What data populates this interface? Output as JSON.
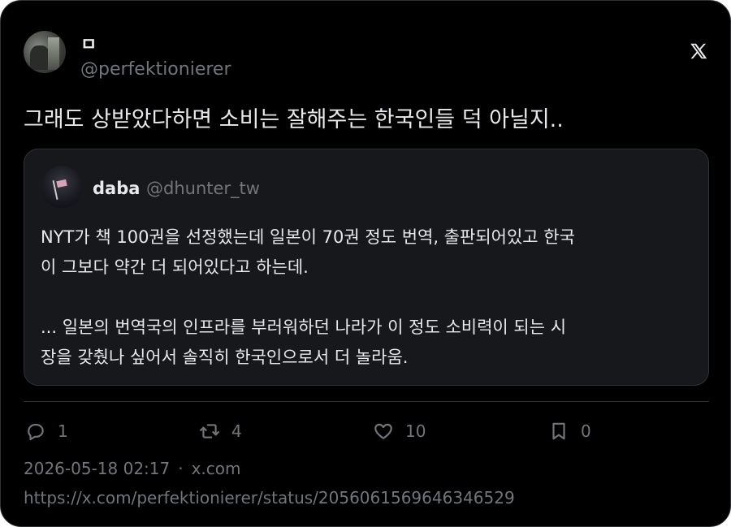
{
  "tweet": {
    "display_name": "ㅁ",
    "handle": "@perfektionierer",
    "text": "그래도 상받았다하면 소비는 잘해주는 한국인들 덕 아닐지..",
    "platform_icon": "x-logo-icon"
  },
  "quote": {
    "display_name": "daba",
    "handle": "@dhunter_tw",
    "lines": [
      "NYT가 책 100권을 선정했는데 일본이 70권 정도 번역, 출판되어있고 한국",
      "이 그보다 약간 더 되어있다고 하는데.",
      "",
      "... 일본의 번역국의 인프라를 부러워하던 나라가 이 정도 소비력이 되는 시",
      "장을 갖췄나 싶어서 솔직히 한국인으로서 더 놀라움."
    ]
  },
  "actions": {
    "replies": "1",
    "retweets": "4",
    "likes": "10",
    "bookmarks": "0"
  },
  "meta": {
    "timestamp": "2026-05-18 02:17",
    "separator": "·",
    "source": "x.com",
    "url": "https://x.com/perfektionierer/status/2056061569646346529"
  },
  "colors": {
    "background": "#000000",
    "quote_background": "#16181c",
    "border": "#2f3336",
    "text": "#e7e9ea",
    "muted": "#71767b"
  }
}
